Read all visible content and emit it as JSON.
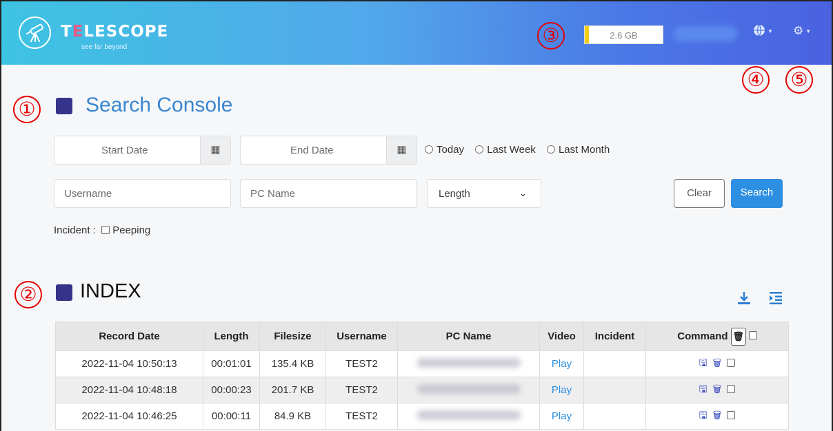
{
  "header": {
    "brand_prefix": "T",
    "brand_accent": "E",
    "brand_suffix": "LESCOPE",
    "tagline": "see far beyond",
    "storage": "2.6 GB",
    "storage_level": 0.05
  },
  "callouts": [
    "①",
    "②",
    "③",
    "④",
    "⑤"
  ],
  "search": {
    "title": "Search Console",
    "start_date_placeholder": "Start Date",
    "end_date_placeholder": "End Date",
    "radios": [
      "Today",
      "Last Week",
      "Last Month"
    ],
    "username_placeholder": "Username",
    "pcname_placeholder": "PC Name",
    "length_select": "Length",
    "clear_label": "Clear",
    "search_label": "Search",
    "incident_label": "Incident :",
    "incident_option": "Peeping"
  },
  "index": {
    "title": "INDEX",
    "columns": [
      "Record Date",
      "Length",
      "Filesize",
      "Username",
      "PC Name",
      "Video",
      "Incident",
      "Command"
    ],
    "rows": [
      {
        "date": "2022-11-04 10:50:13",
        "length": "00:01:01",
        "filesize": "135.4 KB",
        "username": "TEST2",
        "video": "Play"
      },
      {
        "date": "2022-11-04 10:48:18",
        "length": "00:00:23",
        "filesize": "201.7 KB",
        "username": "TEST2",
        "video": "Play"
      },
      {
        "date": "2022-11-04 10:46:25",
        "length": "00:00:11",
        "filesize": "84.9 KB",
        "username": "TEST2",
        "video": "Play"
      }
    ]
  },
  "colors": {
    "accent": "#2d8fe1",
    "section_square": "#35338a",
    "callout_red": "#e60000"
  },
  "icons": [
    "telescope-logo-icon",
    "calendar-icon",
    "globe-icon",
    "gear-icon",
    "download-icon",
    "indent-icon",
    "save-icon",
    "trash-icon"
  ]
}
